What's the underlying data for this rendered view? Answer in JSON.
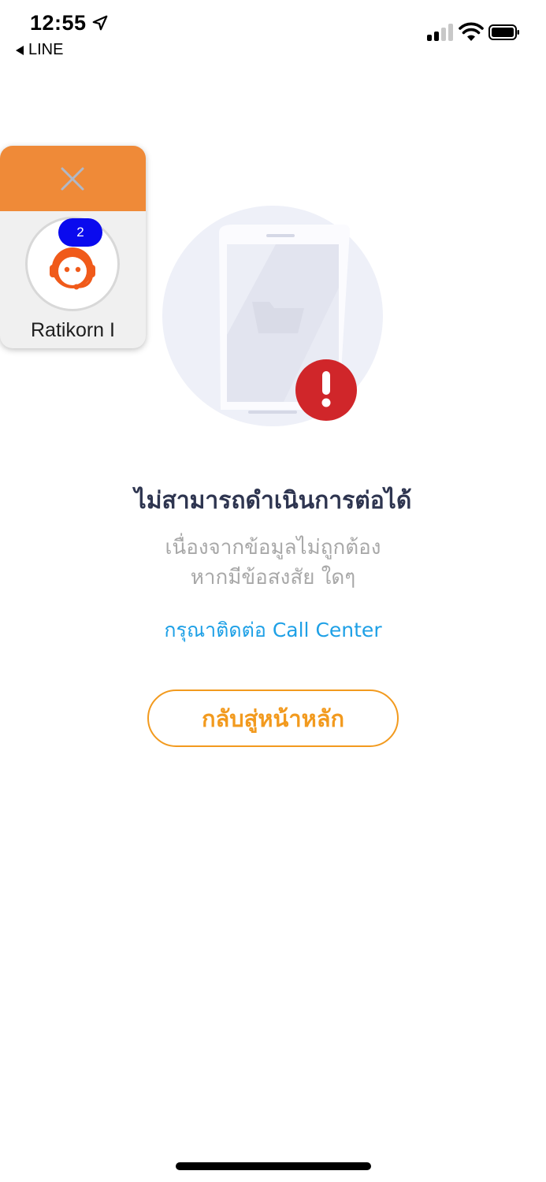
{
  "status_bar": {
    "time": "12:55",
    "back_label": "LINE",
    "location_icon": "location-arrow-icon",
    "signal_icon": "cellular-signal-icon",
    "wifi_icon": "wifi-icon",
    "battery_icon": "battery-icon"
  },
  "chat_widget": {
    "close_icon": "close-icon",
    "avatar_icon": "support-agent-icon",
    "badge_count": "2",
    "name": "Ratikorn I",
    "colors": {
      "header": "#ef8a38",
      "badge": "#0a0aee"
    }
  },
  "illustration": {
    "icon": "phone-error-icon",
    "alert_icon": "exclamation-icon",
    "alert_color": "#d0262a"
  },
  "error": {
    "title": "ไม่สามารถดำเนินการต่อได้",
    "description_line1": "เนื่องจากข้อมูลไม่ถูกต้อง",
    "description_line2": "หากมีข้อสงสัย ใดๆ",
    "contact_link": "กรุณาติดต่อ Call Center"
  },
  "actions": {
    "home_button_label": "กลับสู่หน้าหลัก",
    "accent_color": "#f29a1e"
  }
}
